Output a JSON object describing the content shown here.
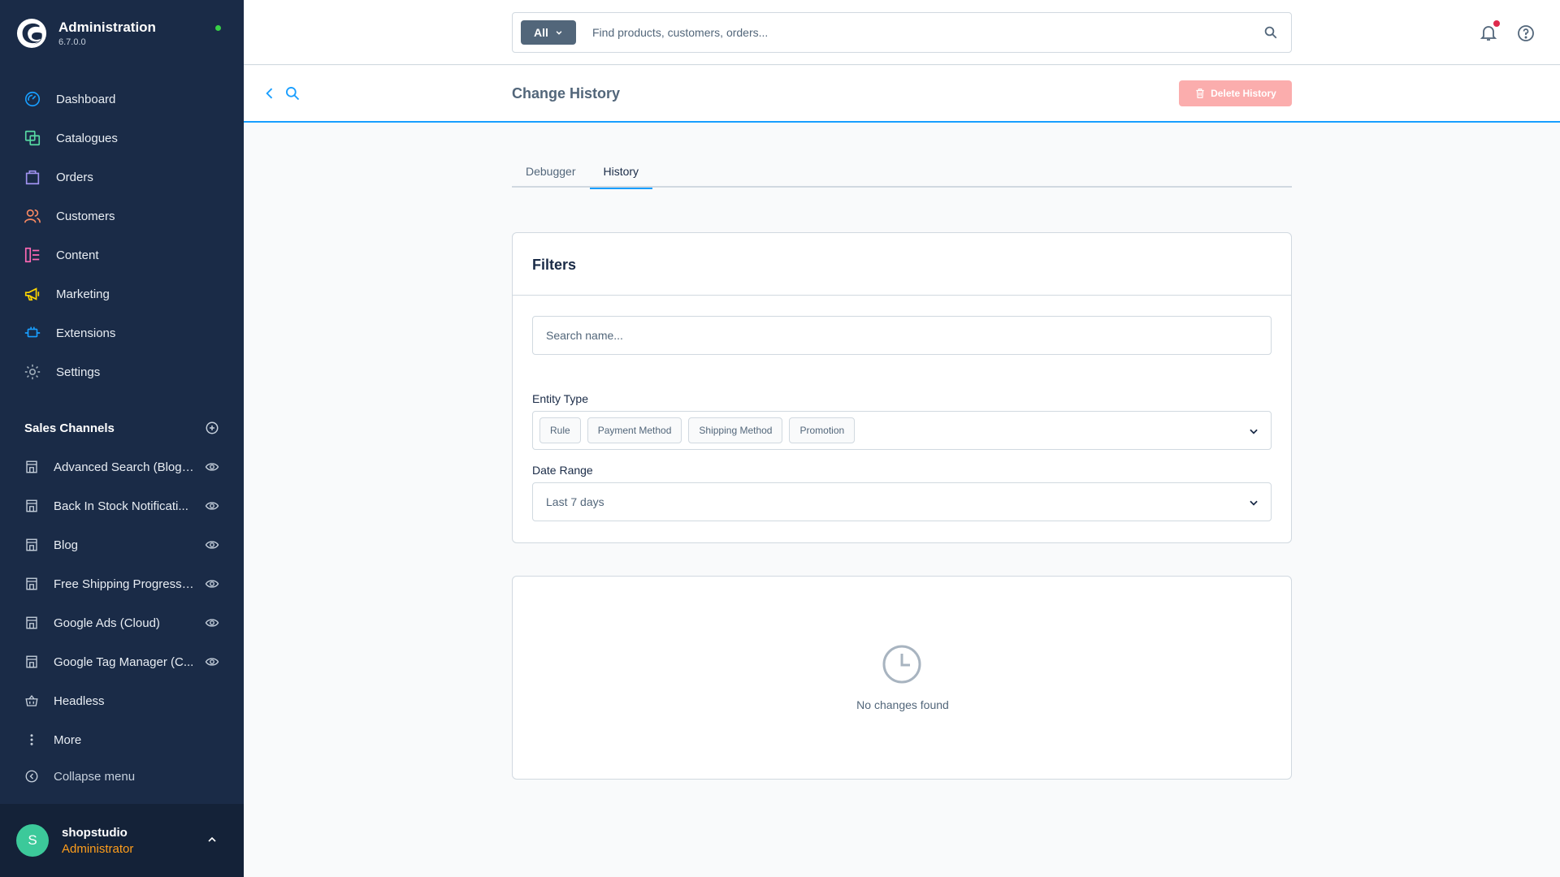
{
  "app": {
    "title": "Administration",
    "version": "6.7.0.0"
  },
  "sidebar": {
    "nav": [
      {
        "label": "Dashboard",
        "icon": "dashboard-icon",
        "color": "#189eff"
      },
      {
        "label": "Catalogues",
        "icon": "products-icon",
        "color": "#57d9a3"
      },
      {
        "label": "Orders",
        "icon": "shopping-bag-icon",
        "color": "#a092f0"
      },
      {
        "label": "Customers",
        "icon": "users-icon",
        "color": "#f88962"
      },
      {
        "label": "Content",
        "icon": "content-icon",
        "color": "#ff68b4"
      },
      {
        "label": "Marketing",
        "icon": "megaphone-icon",
        "color": "#ffd700"
      },
      {
        "label": "Extensions",
        "icon": "plug-icon",
        "color": "#189eff"
      },
      {
        "label": "Settings",
        "icon": "gear-icon",
        "color": "#9aa8b5"
      }
    ],
    "sales_channels_title": "Sales Channels",
    "sales_channels": [
      {
        "label": "Advanced Search (Blog ..."
      },
      {
        "label": "Back In Stock Notificati..."
      },
      {
        "label": "Blog"
      },
      {
        "label": "Free Shipping Progress ..."
      },
      {
        "label": "Google Ads (Cloud)"
      },
      {
        "label": "Google Tag Manager (C..."
      },
      {
        "label": "Headless"
      },
      {
        "label": "More"
      }
    ],
    "collapse_label": "Collapse menu",
    "user": {
      "initial": "S",
      "name": "shopstudio",
      "role": "Administrator"
    }
  },
  "topbar": {
    "search_type": "All",
    "search_placeholder": "Find products, customers, orders..."
  },
  "page": {
    "title": "Change History",
    "delete_button": "Delete History",
    "tabs": [
      {
        "label": "Debugger",
        "active": false
      },
      {
        "label": "History",
        "active": true
      }
    ],
    "filters": {
      "title": "Filters",
      "name_placeholder": "Search name...",
      "entity_type_label": "Entity Type",
      "entity_types": [
        "Rule",
        "Payment Method",
        "Shipping Method",
        "Promotion"
      ],
      "date_range_label": "Date Range",
      "date_range_value": "Last 7 days"
    },
    "empty_state": "No changes found"
  },
  "colors": {
    "sidebar_bg": "#1a2b47",
    "accent": "#189eff",
    "delete_button": "#fbadad",
    "role": "#ff9e1b",
    "status_online": "#37d046",
    "notification_dot": "#de294c"
  }
}
